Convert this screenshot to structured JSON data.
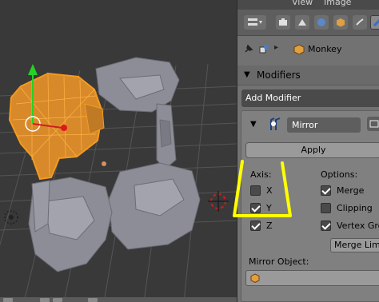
{
  "topbar": {
    "menu_view": "View",
    "menu_image": "Image"
  },
  "breadcrumb": {
    "object_name": "Monkey"
  },
  "modifiers": {
    "panel_title": "Modifiers",
    "add_modifier": "Add Modifier",
    "modifier_name": "Mirror",
    "apply_label": "Apply",
    "axis_heading": "Axis:",
    "options_heading": "Options:",
    "axis": [
      {
        "label": "X",
        "checked": false
      },
      {
        "label": "Y",
        "checked": true
      },
      {
        "label": "Z",
        "checked": true
      }
    ],
    "options": [
      {
        "label": "Merge",
        "checked": true
      },
      {
        "label": "Clipping",
        "checked": false
      },
      {
        "label": "Vertex Groups",
        "checked": true
      }
    ],
    "merge_limit_label": "Merge Limit",
    "mirror_object_label": "Mirror Object:"
  },
  "colors": {
    "selected_orange": "#f49b1e",
    "annotation_yellow": "#ffff00",
    "mesh_gray": "#8e8e98",
    "panel_bg": "#727272"
  }
}
